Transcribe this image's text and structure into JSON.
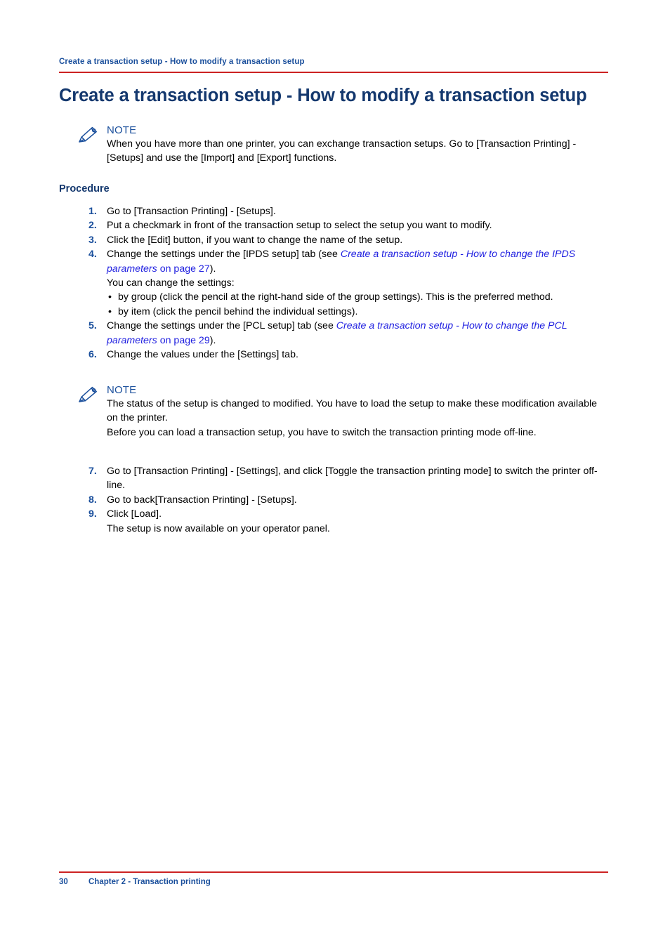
{
  "header": {
    "text": "Create a transaction setup - How to modify a transaction setup",
    "rule_color": "#cc2222"
  },
  "title": "Create a transaction setup - How to modify a transaction setup",
  "note_1": {
    "icon": "pencil-icon",
    "label": "NOTE",
    "text": "When you have more than one printer, you can exchange transaction setups. Go to [Transaction Printing] - [Setups] and use the [Import] and [Export] functions."
  },
  "procedure": {
    "heading": "Procedure",
    "steps": [
      {
        "number": "1.",
        "text": "Go to [Transaction Printing] - [Setups]."
      },
      {
        "number": "2.",
        "text": "Put a checkmark in front of the transaction setup to select the setup you want to modify."
      },
      {
        "number": "3.",
        "text": "Click the [Edit] button, if you want to change the name of the setup."
      },
      {
        "number": "4.",
        "lead": "Change the settings under the [IPDS setup] tab (see ",
        "xref_title": "Create a transaction setup - How to change the IPDS parameters",
        "xref_page": " on page 27",
        "tail": ").",
        "subline": "You can change the settings:",
        "bullets": [
          {
            "marker": "•",
            "text": "by group (click the pencil at the right-hand side of the group settings). This is the preferred method."
          },
          {
            "marker": "•",
            "text": "by item (click the pencil behind the individual settings)."
          }
        ]
      },
      {
        "number": "5.",
        "lead": "Change the settings under the [PCL setup] tab (see ",
        "xref_title": "Create a transaction setup - How to change the PCL parameters",
        "xref_page": " on page 29",
        "tail": ")."
      },
      {
        "number": "6.",
        "text": "Change the values under the [Settings] tab."
      },
      {
        "number": "7.",
        "text": "Go to [Transaction Printing] - [Settings], and click [Toggle the transaction printing mode] to switch the printer off-line."
      },
      {
        "number": "8.",
        "text": "Go to back[Transaction Printing] - [Setups]."
      },
      {
        "number": "9.",
        "text": "Click [Load].",
        "subline": "The setup is now available on your operator panel."
      }
    ]
  },
  "note_2": {
    "icon": "pencil-icon",
    "label": "NOTE",
    "text_line_1": "The status of the setup is changed to modified. You have to load the setup to make these modification available on the printer.",
    "text_line_2": "Before you can load a transaction setup, you have to switch the transaction printing mode off-line."
  },
  "footer": {
    "page_number": "30",
    "chapter": "Chapter 2 - Transaction printing",
    "rule_color": "#cc2222"
  },
  "colors": {
    "rule_red": "#cc2222",
    "heading_navy": "#14386e",
    "accent_blue": "#1a4f9c",
    "xref_blue": "#1e1ee0",
    "body_black": "#000000"
  }
}
